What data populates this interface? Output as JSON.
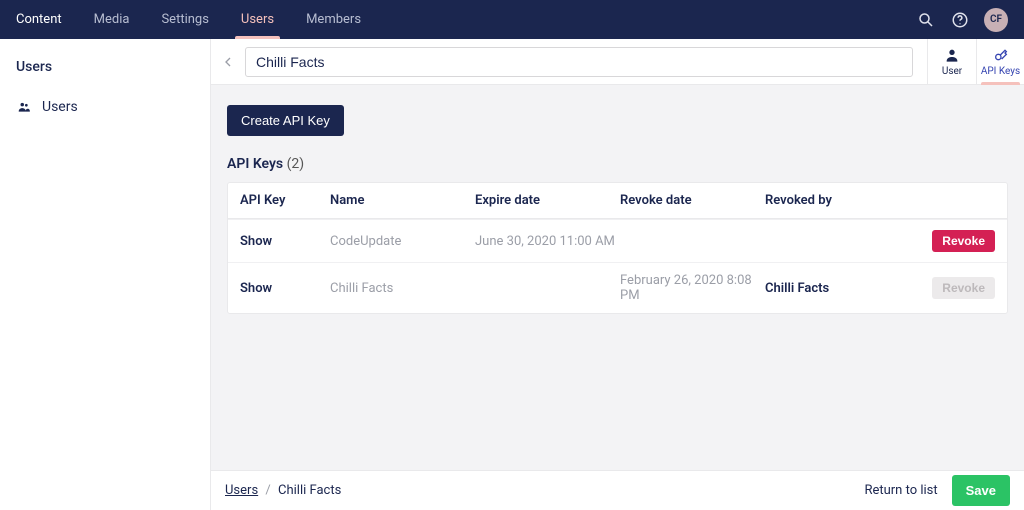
{
  "topnav": {
    "items": [
      "Content",
      "Media",
      "Settings",
      "Users",
      "Members"
    ],
    "active_index": 3
  },
  "avatar_initials": "CF",
  "sidebar": {
    "header": "Users",
    "tree": [
      {
        "label": "Users"
      }
    ]
  },
  "editor": {
    "name": "Chilli Facts",
    "tabs": [
      {
        "label": "User"
      },
      {
        "label": "API Keys"
      }
    ],
    "active_tab": 1
  },
  "content": {
    "create_btn": "Create API Key",
    "section_title": "API Keys",
    "count": "(2)",
    "columns": [
      "API Key",
      "Name",
      "Expire date",
      "Revoke date",
      "Revoked by"
    ],
    "rows": [
      {
        "show": "Show",
        "name": "CodeUpdate",
        "expire": "June 30, 2020 11:00 AM",
        "revoke_date": "",
        "revoked_by": "",
        "revoke_btn": "Revoke",
        "revoked": false
      },
      {
        "show": "Show",
        "name": "Chilli Facts",
        "expire": "",
        "revoke_date": "February 26, 2020 8:08 PM",
        "revoked_by": "Chilli Facts",
        "revoke_btn": "Revoke",
        "revoked": true
      }
    ]
  },
  "footer": {
    "crumb_root": "Users",
    "crumb_sep": "/",
    "crumb_current": "Chilli Facts",
    "return": "Return to list",
    "save": "Save"
  }
}
